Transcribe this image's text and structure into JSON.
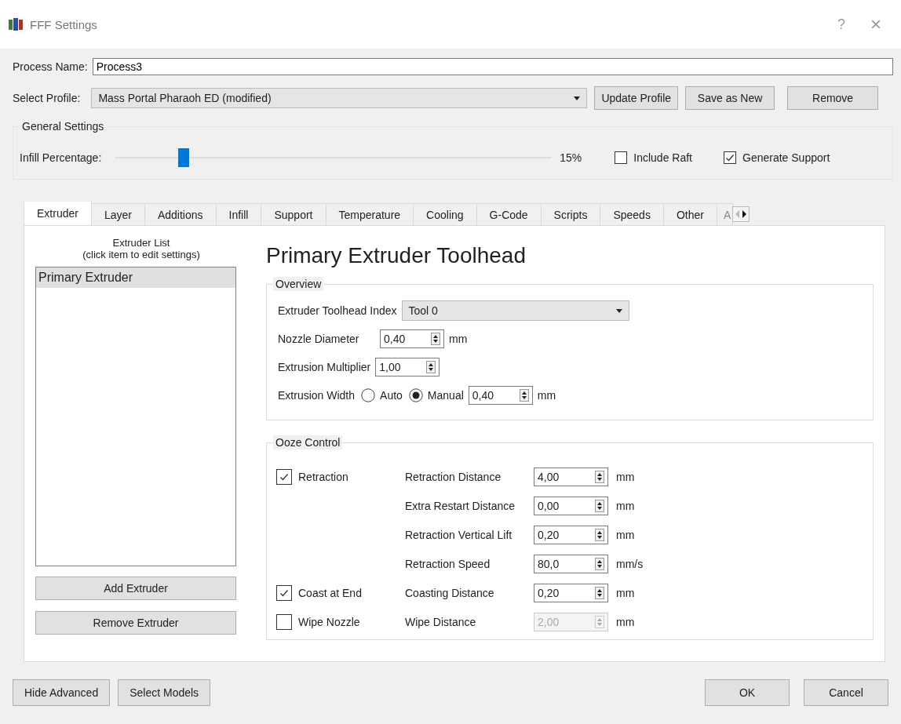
{
  "window": {
    "title": "FFF Settings",
    "help": "?",
    "close": "×"
  },
  "process_name": {
    "label": "Process Name:",
    "value": "Process3"
  },
  "select_profile": {
    "label": "Select Profile:",
    "value": "Mass Portal Pharaoh ED (modified)",
    "buttons": [
      "Update Profile",
      "Save as New",
      "Remove"
    ]
  },
  "general_settings": {
    "legend": "General Settings",
    "infill": {
      "label": "Infill Percentage:",
      "level": 0.15,
      "reading": "15%"
    },
    "checkboxes": [
      {
        "label": "Include Raft",
        "checked": false
      },
      {
        "label": "Generate Support",
        "checked": true
      }
    ]
  },
  "tabs": [
    {
      "label": "Extruder",
      "selected": true
    },
    {
      "label": "Layer",
      "selected": false
    },
    {
      "label": "Additions",
      "selected": false
    },
    {
      "label": "Infill",
      "selected": false
    },
    {
      "label": "Support",
      "selected": false
    },
    {
      "label": "Temperature",
      "selected": false
    },
    {
      "label": "Cooling",
      "selected": false
    },
    {
      "label": "G-Code",
      "selected": false
    },
    {
      "label": "Scripts",
      "selected": false
    },
    {
      "label": "Speeds",
      "selected": false
    },
    {
      "label": "Other",
      "selected": false
    },
    {
      "label": "A",
      "selected": false
    }
  ],
  "extruder_list": {
    "title": "Extruder List",
    "hint": "(click item to edit settings)",
    "items": [
      {
        "label": "Primary Extruder",
        "selected": true
      }
    ],
    "buttons": [
      "Add Extruder",
      "Remove Extruder"
    ]
  },
  "heading": "Primary Extruder Toolhead",
  "overview": {
    "legend": "Overview",
    "toolhead_index": {
      "label": "Extruder Toolhead Index",
      "value": "Tool 0"
    },
    "nozzle_diameter": {
      "label": "Nozzle Diameter",
      "value": "0,40",
      "unit": "mm"
    },
    "extrusion_multiplier": {
      "label": "Extrusion Multiplier",
      "value": "1,00"
    },
    "extrusion_width": {
      "label": "Extrusion Width",
      "options": [
        {
          "label": "Auto",
          "selected": false
        },
        {
          "label": "Manual",
          "selected": true
        }
      ],
      "value": "0,40",
      "unit": "mm"
    }
  },
  "ooze_control": {
    "legend": "Ooze Control",
    "rows": [
      {
        "toggle": {
          "label": "Retraction",
          "checked": true
        },
        "label": "Retraction Distance",
        "value": "4,00",
        "unit": "mm",
        "disabled": false
      },
      {
        "label": "Extra Restart Distance",
        "value": "0,00",
        "unit": "mm",
        "disabled": false
      },
      {
        "label": "Retraction Vertical Lift",
        "value": "0,20",
        "unit": "mm",
        "disabled": false
      },
      {
        "label": "Retraction Speed",
        "value": "80,0",
        "unit": "mm/s",
        "disabled": false
      },
      {
        "toggle": {
          "label": "Coast at End",
          "checked": true
        },
        "label": "Coasting Distance",
        "value": "0,20",
        "unit": "mm",
        "disabled": false
      },
      {
        "toggle": {
          "label": "Wipe Nozzle",
          "checked": false
        },
        "label": "Wipe Distance",
        "value": "2,00",
        "unit": "mm",
        "disabled": true
      }
    ]
  },
  "footer": {
    "left_buttons": [
      "Hide Advanced",
      "Select Models"
    ],
    "right_buttons": [
      "OK",
      "Cancel"
    ]
  }
}
